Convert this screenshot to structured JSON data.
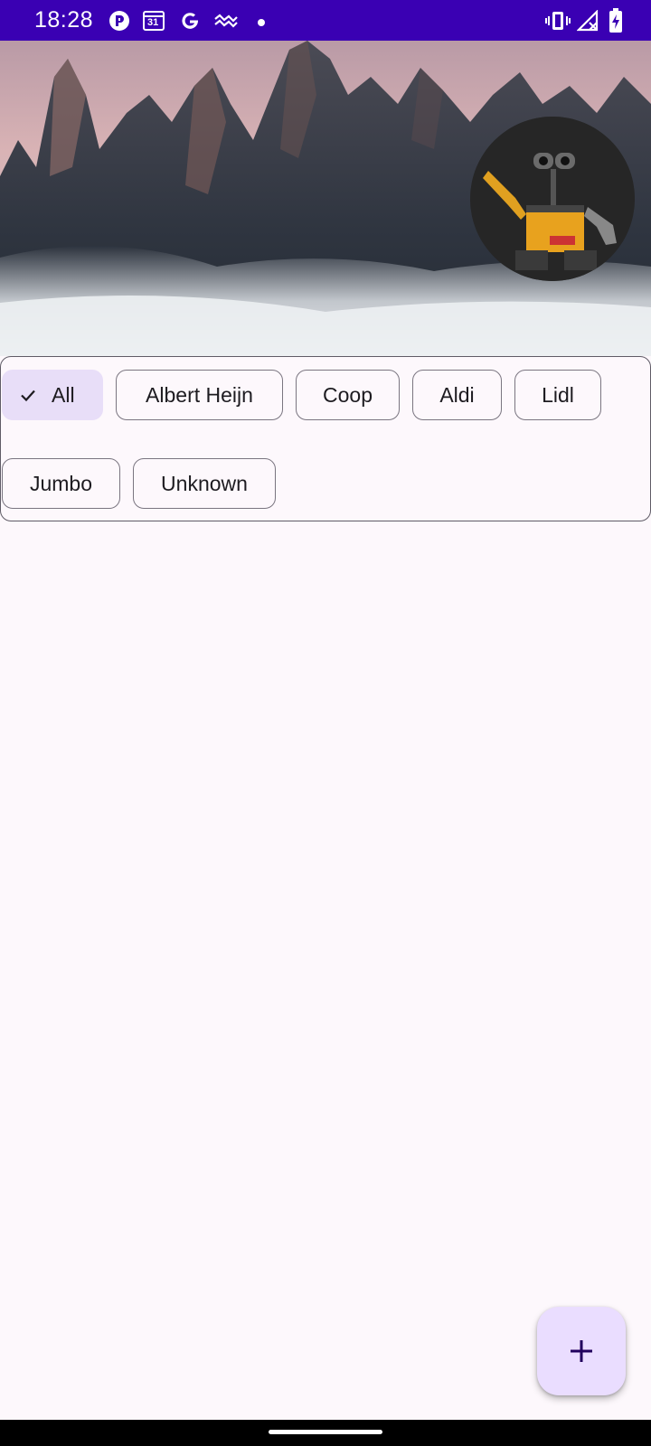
{
  "status_bar": {
    "time": "18:28",
    "background": "#3a00b3",
    "left_icons": [
      "notification-app-icon",
      "calendar-icon",
      "google-icon",
      "wave-icon",
      "dot-icon"
    ],
    "calendar_day": "31",
    "right_icons": [
      "vibrate-icon",
      "no-signal-icon",
      "battery-charging-icon"
    ]
  },
  "header": {
    "banner": "mountain-landscape-image",
    "avatar": "robot-avatar-image"
  },
  "filters": {
    "selected": "All",
    "chips": [
      {
        "label": "All",
        "selected": true
      },
      {
        "label": "Albert Heijn",
        "selected": false
      },
      {
        "label": "Coop",
        "selected": false
      },
      {
        "label": "Aldi",
        "selected": false
      },
      {
        "label": "Lidl",
        "selected": false
      },
      {
        "label": "Jumbo",
        "selected": false
      },
      {
        "label": "Unknown",
        "selected": false
      }
    ]
  },
  "fab": {
    "icon": "plus-icon",
    "background": "#eaddff"
  },
  "colors": {
    "accent": "#3a00b3",
    "chip_selected": "#e8def8",
    "surface": "#fdf8fc"
  }
}
